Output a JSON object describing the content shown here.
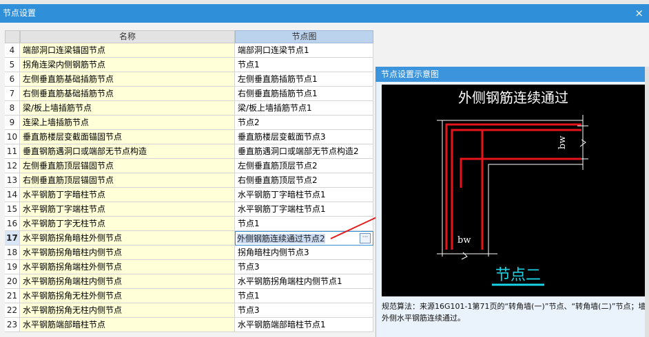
{
  "window": {
    "title": "节点设置",
    "close_glyph": "×"
  },
  "table": {
    "headers": {
      "name": "名称",
      "node": "节点图"
    },
    "rows": [
      {
        "num": "4",
        "name": "端部洞口连梁锚固节点",
        "node": "端部洞口连梁节点1"
      },
      {
        "num": "5",
        "name": "拐角连梁内侧钢筋节点",
        "node": "节点1"
      },
      {
        "num": "6",
        "name": "左侧垂直筋基础插筋节点",
        "node": "左侧垂直筋插筋节点1"
      },
      {
        "num": "7",
        "name": "右侧垂直筋基础插筋节点",
        "node": "右侧垂直筋插筋节点1"
      },
      {
        "num": "8",
        "name": "梁/板上墙插筋节点",
        "node": "梁/板上墙插筋节点1"
      },
      {
        "num": "9",
        "name": "连梁上墙插筋节点",
        "node": "节点2"
      },
      {
        "num": "10",
        "name": "垂直筋楼层变截面锚固节点",
        "node": "垂直筋楼层变截面节点3"
      },
      {
        "num": "11",
        "name": "垂直钢筋遇洞口或端部无节点构造",
        "node": "垂直筋遇洞口或端部无节点构造2"
      },
      {
        "num": "12",
        "name": "左侧垂直筋顶层锚固节点",
        "node": "左侧垂直筋顶层节点2"
      },
      {
        "num": "13",
        "name": "右侧垂直筋顶层锚固节点",
        "node": "右侧垂直筋顶层节点2"
      },
      {
        "num": "14",
        "name": "水平钢筋丁字暗柱节点",
        "node": "水平钢筋丁字暗柱节点1"
      },
      {
        "num": "15",
        "name": "水平钢筋丁字端柱节点",
        "node": "水平钢筋丁字端柱节点1"
      },
      {
        "num": "16",
        "name": "水平钢筋丁字无柱节点",
        "node": "节点1"
      },
      {
        "num": "17",
        "name": "水平钢筋拐角暗柱外侧节点",
        "node": "外侧钢筋连续通过节点2",
        "selected": true
      },
      {
        "num": "18",
        "name": "水平钢筋拐角暗柱内侧节点",
        "node": "拐角暗柱内侧节点3"
      },
      {
        "num": "19",
        "name": "水平钢筋拐角端柱外侧节点",
        "node": "节点3"
      },
      {
        "num": "20",
        "name": "水平钢筋拐角端柱内侧节点",
        "node": "水平钢筋拐角端柱内侧节点1"
      },
      {
        "num": "21",
        "name": "水平钢筋拐角无柱外侧节点",
        "node": "节点1"
      },
      {
        "num": "22",
        "name": "水平钢筋拐角无柱内侧节点",
        "node": "节点3"
      },
      {
        "num": "23",
        "name": "水平钢筋端部暗柱节点",
        "node": "水平钢筋端部暗柱节点1"
      }
    ],
    "ellipsis_glyph": "···"
  },
  "preview": {
    "title": "节点设置示意图",
    "diagram_title": "外侧钢筋连续通过",
    "dim_label_vertical": "bw",
    "dim_label_horizontal": "bw",
    "caption": "节点二",
    "description": "规范算法：来源16G101-1第71页的“转角墙(一)”节点、“转角墙(二)”节点；墙外侧水平钢筋连续通过。"
  },
  "colors": {
    "titlebar": "#2f8fd8",
    "name_cell_bg": "#ffffd8",
    "rebar_red": "#e8141c",
    "caption_cyan": "#19d4e8",
    "arrow_red": "#e31b1b"
  }
}
